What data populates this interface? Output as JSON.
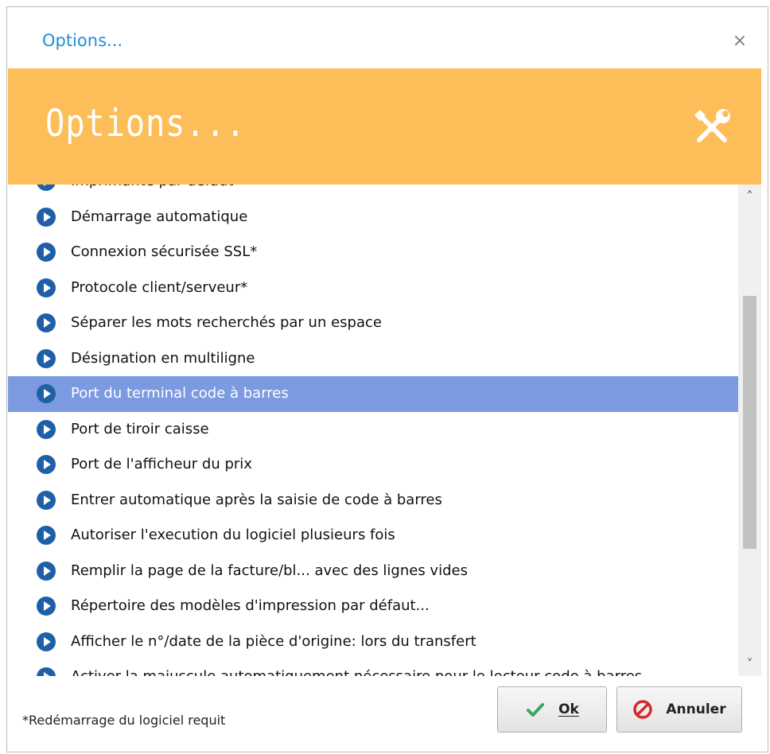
{
  "window": {
    "title": "Options...",
    "close_glyph": "×"
  },
  "banner": {
    "title": "Options...",
    "icon": "tools-icon",
    "color": "#fdbd58"
  },
  "list": {
    "items": [
      {
        "label": "Imprimante par défaut",
        "selected": false
      },
      {
        "label": "Démarrage automatique",
        "selected": false
      },
      {
        "label": "Connexion sécurisée SSL*",
        "selected": false
      },
      {
        "label": "Protocole client/serveur*",
        "selected": false
      },
      {
        "label": "Séparer les mots recherchés par un espace",
        "selected": false
      },
      {
        "label": "Désignation en multiligne",
        "selected": false
      },
      {
        "label": "Port du terminal code à barres",
        "selected": true
      },
      {
        "label": "Port de tiroir caisse",
        "selected": false
      },
      {
        "label": "Port de l'afficheur du prix",
        "selected": false
      },
      {
        "label": "Entrer automatique après la saisie de code à barres",
        "selected": false
      },
      {
        "label": "Autoriser l'execution du logiciel plusieurs fois",
        "selected": false
      },
      {
        "label": "Remplir la page de la facture/bl... avec des lignes vides",
        "selected": false
      },
      {
        "label": "Répertoire des modèles d'impression par défaut...",
        "selected": false
      },
      {
        "label": "Afficher le n°/date de la pièce d'origine: lors du transfert",
        "selected": false
      },
      {
        "label": "Activer la majuscule automatiquement nécessaire pour le lecteur code à barres",
        "selected": false
      }
    ],
    "item_icon": "play-circle-icon",
    "selection_color": "#7b9ae0"
  },
  "scrollbar": {
    "up_glyph": "˄",
    "down_glyph": "˅"
  },
  "footer": {
    "note": "*Redémarrage du logiciel requit",
    "ok_label": "Ok",
    "cancel_label": "Annuler"
  }
}
